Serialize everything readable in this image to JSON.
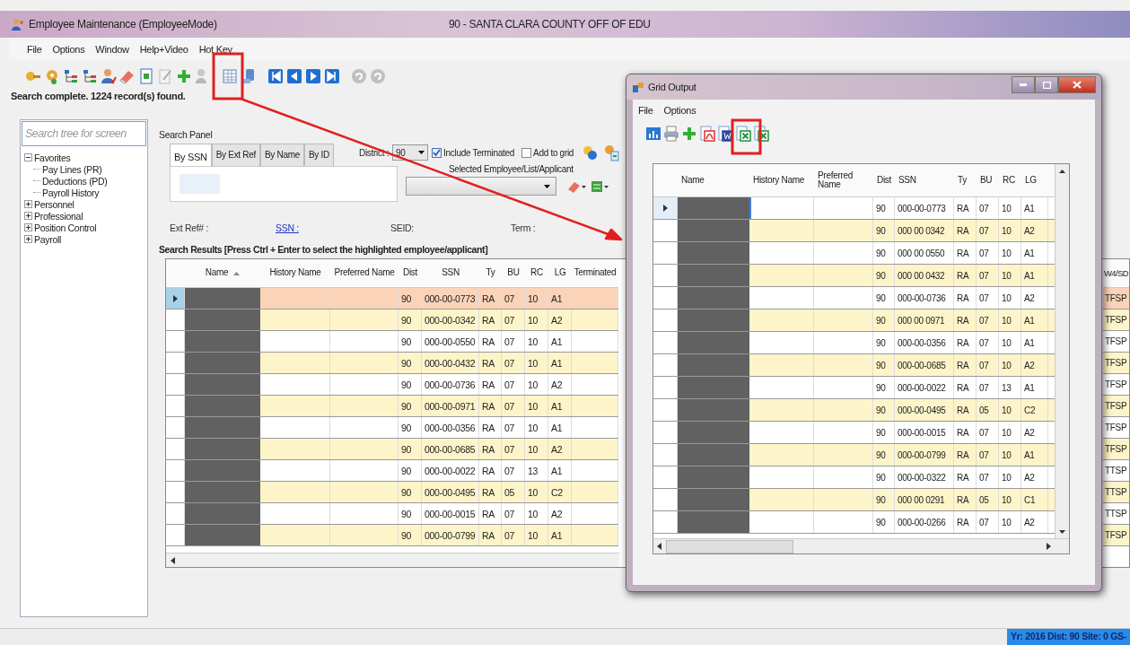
{
  "window": {
    "title": "Employee Maintenance (EmployeeMode)",
    "district_title": "90 - SANTA CLARA COUNTY OFF OF EDU"
  },
  "menu": [
    "File",
    "Options",
    "Window",
    "Help+Video",
    "Hot Key"
  ],
  "status_message": "Search complete. 1224 record(s) found.",
  "tree": {
    "search_placeholder": "Search tree for screen",
    "items": [
      {
        "label": "Favorites",
        "expanded": true,
        "children": [
          {
            "label": "Pay Lines (PR)"
          },
          {
            "label": "Deductions (PD)"
          },
          {
            "label": "Payroll History"
          }
        ]
      },
      {
        "label": "Personnel",
        "expanded": false
      },
      {
        "label": "Professional",
        "expanded": false
      },
      {
        "label": "Position Control",
        "expanded": false
      },
      {
        "label": "Payroll",
        "expanded": false
      }
    ]
  },
  "search_panel": {
    "title": "Search Panel",
    "tabs": [
      {
        "label": "By SSN",
        "selected": true
      },
      {
        "label": "By Ext Ref",
        "selected": false
      },
      {
        "label": "By Name",
        "selected": false
      },
      {
        "label": "By ID",
        "selected": false
      }
    ],
    "district_label": "District :",
    "district_value": "90",
    "checkboxes": [
      {
        "label": "Include Terminated",
        "checked": true
      },
      {
        "label": "Add to grid",
        "checked": false
      }
    ],
    "selected_list_label": "Selected Employee/List/Applicant",
    "info_fields": [
      {
        "label": "Ext Ref# :",
        "kind": "text"
      },
      {
        "label": "SSN :",
        "kind": "link"
      },
      {
        "label": "SEID:",
        "kind": "text"
      },
      {
        "label": "Term :",
        "kind": "text"
      }
    ]
  },
  "results": {
    "title": "Search Results [Press Ctrl + Enter to select the highlighted employee/applicant]",
    "columns": [
      {
        "label": "Name",
        "sorted": true
      },
      {
        "label": "History Name",
        "sorted": false
      },
      {
        "label": "Preferred Name",
        "sorted": false
      },
      {
        "label": "Dist",
        "sorted": false
      },
      {
        "label": "SSN",
        "sorted": false
      },
      {
        "label": "Ty",
        "sorted": false
      },
      {
        "label": "BU",
        "sorted": false
      },
      {
        "label": "RC",
        "sorted": false
      },
      {
        "label": "LG",
        "sorted": false
      },
      {
        "label": "Terminated",
        "sorted": false
      },
      {
        "label": "W4/SD",
        "sorted": false
      }
    ],
    "rows": [
      {
        "selected": true,
        "dist": "90",
        "ssn": "000-00-0773",
        "ty": "RA",
        "bu": "07",
        "rc": "10",
        "lg": "A1",
        "w4": "TFSP"
      },
      {
        "selected": false,
        "dist": "90",
        "ssn": "000-00-0342",
        "ty": "RA",
        "bu": "07",
        "rc": "10",
        "lg": "A2",
        "w4": "TFSP"
      },
      {
        "selected": false,
        "dist": "90",
        "ssn": "000-00-0550",
        "ty": "RA",
        "bu": "07",
        "rc": "10",
        "lg": "A1",
        "w4": "TFSP"
      },
      {
        "selected": false,
        "dist": "90",
        "ssn": "000-00-0432",
        "ty": "RA",
        "bu": "07",
        "rc": "10",
        "lg": "A1",
        "w4": "TFSP"
      },
      {
        "selected": false,
        "dist": "90",
        "ssn": "000-00-0736",
        "ty": "RA",
        "bu": "07",
        "rc": "10",
        "lg": "A2",
        "w4": "TFSP"
      },
      {
        "selected": false,
        "dist": "90",
        "ssn": "000-00-0971",
        "ty": "RA",
        "bu": "07",
        "rc": "10",
        "lg": "A1",
        "w4": "TFSP"
      },
      {
        "selected": false,
        "dist": "90",
        "ssn": "000-00-0356",
        "ty": "RA",
        "bu": "07",
        "rc": "10",
        "lg": "A1",
        "w4": "TFSP"
      },
      {
        "selected": false,
        "dist": "90",
        "ssn": "000-00-0685",
        "ty": "RA",
        "bu": "07",
        "rc": "10",
        "lg": "A2",
        "w4": "TFSP"
      },
      {
        "selected": false,
        "dist": "90",
        "ssn": "000-00-0022",
        "ty": "RA",
        "bu": "07",
        "rc": "13",
        "lg": "A1",
        "w4": "TTSP"
      },
      {
        "selected": false,
        "dist": "90",
        "ssn": "000-00-0495",
        "ty": "RA",
        "bu": "05",
        "rc": "10",
        "lg": "C2",
        "w4": "TTSP"
      },
      {
        "selected": false,
        "dist": "90",
        "ssn": "000-00-0015",
        "ty": "RA",
        "bu": "07",
        "rc": "10",
        "lg": "A2",
        "w4": "TTSP"
      },
      {
        "selected": false,
        "dist": "90",
        "ssn": "000-00-0799",
        "ty": "RA",
        "bu": "07",
        "rc": "10",
        "lg": "A1",
        "w4": "TFSP"
      }
    ]
  },
  "grid_output": {
    "title": "Grid Output",
    "menu": [
      "File",
      "Options"
    ],
    "columns": [
      "Name",
      "History Name",
      "Preferred Name",
      "Dist",
      "SSN",
      "Ty",
      "BU",
      "RC",
      "LG"
    ],
    "rows": [
      {
        "selected": true,
        "dist": "90",
        "ssn": "000-00-0773",
        "ty": "RA",
        "bu": "07",
        "rc": "10",
        "lg": "A1"
      },
      {
        "selected": false,
        "dist": "90",
        "ssn": "000 00 0342",
        "ty": "RA",
        "bu": "07",
        "rc": "10",
        "lg": "A2"
      },
      {
        "selected": false,
        "dist": "90",
        "ssn": "000 00 0550",
        "ty": "RA",
        "bu": "07",
        "rc": "10",
        "lg": "A1"
      },
      {
        "selected": false,
        "dist": "90",
        "ssn": "000 00 0432",
        "ty": "RA",
        "bu": "07",
        "rc": "10",
        "lg": "A1"
      },
      {
        "selected": false,
        "dist": "90",
        "ssn": "000-00-0736",
        "ty": "RA",
        "bu": "07",
        "rc": "10",
        "lg": "A2"
      },
      {
        "selected": false,
        "dist": "90",
        "ssn": "000 00 0971",
        "ty": "RA",
        "bu": "07",
        "rc": "10",
        "lg": "A1"
      },
      {
        "selected": false,
        "dist": "90",
        "ssn": "000-00-0356",
        "ty": "RA",
        "bu": "07",
        "rc": "10",
        "lg": "A1"
      },
      {
        "selected": false,
        "dist": "90",
        "ssn": "000-00-0685",
        "ty": "RA",
        "bu": "07",
        "rc": "10",
        "lg": "A2"
      },
      {
        "selected": false,
        "dist": "90",
        "ssn": "000-00-0022",
        "ty": "RA",
        "bu": "07",
        "rc": "13",
        "lg": "A1"
      },
      {
        "selected": false,
        "dist": "90",
        "ssn": "000-00-0495",
        "ty": "RA",
        "bu": "05",
        "rc": "10",
        "lg": "C2"
      },
      {
        "selected": false,
        "dist": "90",
        "ssn": "000-00-0015",
        "ty": "RA",
        "bu": "07",
        "rc": "10",
        "lg": "A2"
      },
      {
        "selected": false,
        "dist": "90",
        "ssn": "000-00-0799",
        "ty": "RA",
        "bu": "07",
        "rc": "10",
        "lg": "A1"
      },
      {
        "selected": false,
        "dist": "90",
        "ssn": "000-00-0322",
        "ty": "RA",
        "bu": "07",
        "rc": "10",
        "lg": "A2"
      },
      {
        "selected": false,
        "dist": "90",
        "ssn": "000 00 0291",
        "ty": "RA",
        "bu": "05",
        "rc": "10",
        "lg": "C1"
      },
      {
        "selected": false,
        "dist": "90",
        "ssn": "000-00-0266",
        "ty": "RA",
        "bu": "07",
        "rc": "10",
        "lg": "A2"
      }
    ]
  },
  "status_bar": {
    "text": "Yr: 2016 Dist: 90 Site: 0 GS-"
  }
}
